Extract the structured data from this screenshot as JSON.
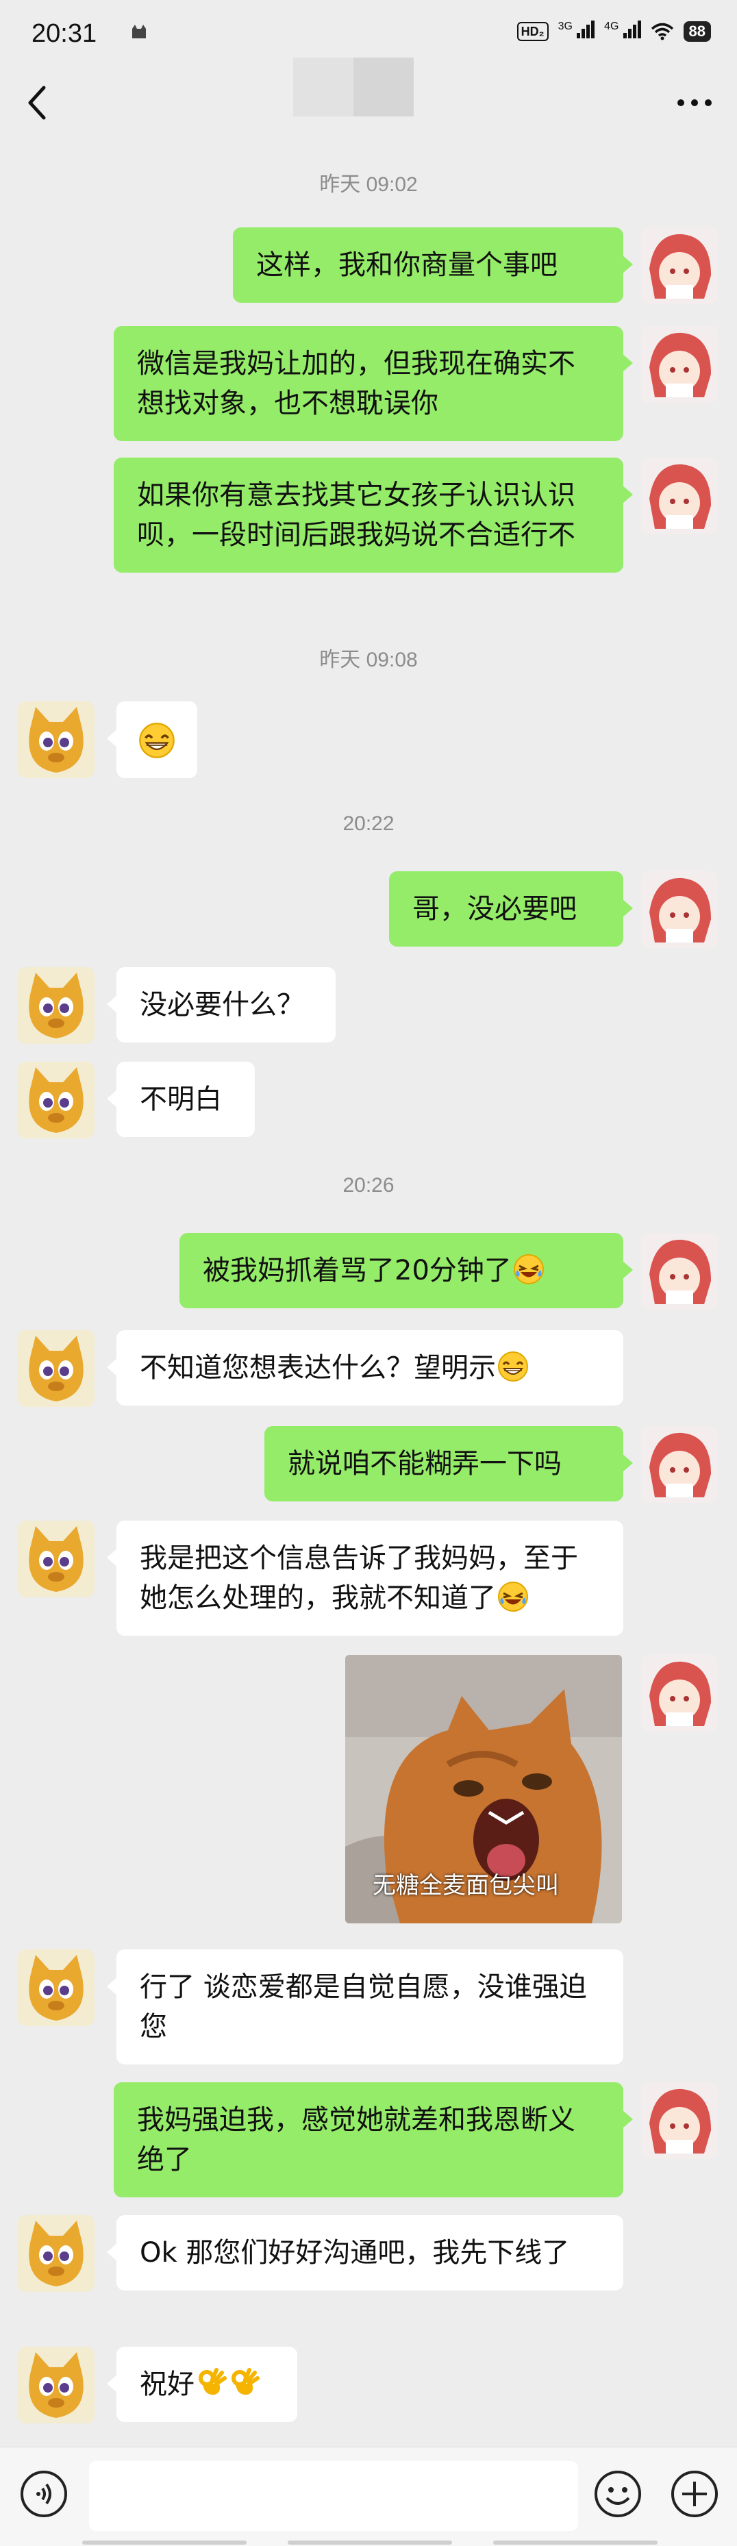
{
  "status_bar": {
    "time": "20:31",
    "network_badge": "HD₂",
    "signal_1": "3G",
    "signal_2": "4G",
    "battery": "88"
  },
  "nav": {
    "back_icon": "chevron-left-icon",
    "more_icon": "more-dots-icon"
  },
  "timestamps": [
    "昨天 09:02",
    "昨天 09:08",
    "20:22",
    "20:26"
  ],
  "messages": [
    {
      "side": "me",
      "text": "这样，我和你商量个事吧"
    },
    {
      "side": "me",
      "text": "微信是我妈让加的，但我现在确实不想找对象，也不想耽误你"
    },
    {
      "side": "me",
      "text": "如果你有意去找其它女孩子认识认识呗，一段时间后跟我妈说不合适行不"
    },
    {
      "side": "other",
      "text": "",
      "emoji": "grin-emoji"
    },
    {
      "side": "me",
      "text": "哥，没必要吧"
    },
    {
      "side": "other",
      "text": "没必要什么？"
    },
    {
      "side": "other",
      "text": "不明白"
    },
    {
      "side": "me",
      "text": "被我妈抓着骂了20分钟了",
      "emoji": "laughing-tears-emoji"
    },
    {
      "side": "other",
      "text": "不知道您想表达什么？望明示",
      "emoji": "grin-emoji"
    },
    {
      "side": "me",
      "text": "就说咱不能糊弄一下吗"
    },
    {
      "side": "other",
      "text": "我是把这个信息告诉了我妈妈，至于她怎么处理的，我就不知道了",
      "emoji": "laughing-tears-emoji"
    },
    {
      "side": "me",
      "type": "image",
      "caption": "无糖全麦面包尖叫"
    },
    {
      "side": "other",
      "text": "行了 谈恋爱都是自觉自愿，没谁强迫您"
    },
    {
      "side": "me",
      "text": "我妈强迫我，感觉她就差和我恩断义绝了"
    },
    {
      "side": "other",
      "text": "Ok 那您们好好沟通吧，我先下线了"
    },
    {
      "side": "other",
      "text": "祝好",
      "emoji": "ok-hand-emoji"
    }
  ],
  "input_bar": {
    "voice_icon": "voice-icon",
    "emoji_icon": "emoji-icon",
    "plus_icon": "plus-icon",
    "input_value": ""
  },
  "colors": {
    "background": "#ededed",
    "my_bubble": "#95ec69",
    "other_bubble": "#ffffff"
  }
}
